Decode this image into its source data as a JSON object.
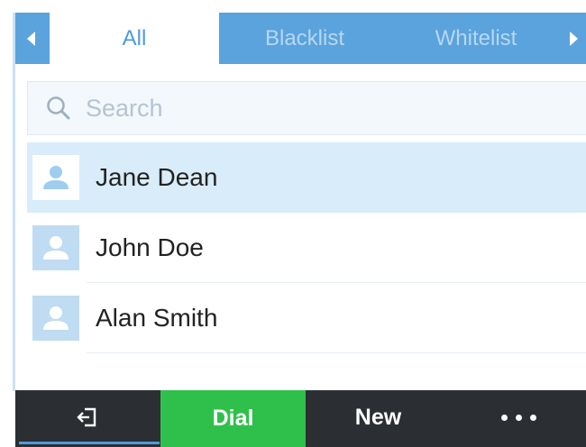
{
  "tabs": [
    {
      "label": "All",
      "active": true
    },
    {
      "label": "Blacklist",
      "active": false
    },
    {
      "label": "Whitelist",
      "active": false
    }
  ],
  "search": {
    "placeholder": "Search",
    "value": "",
    "icon": "search-icon"
  },
  "contacts": [
    {
      "name": "Jane Dean",
      "selected": true,
      "icon": "person-icon"
    },
    {
      "name": "John Doe",
      "selected": false,
      "icon": "person-icon"
    },
    {
      "name": "Alan Smith",
      "selected": false,
      "icon": "person-icon"
    }
  ],
  "bottom_bar": {
    "back_icon": "exit-icon",
    "dial_label": "Dial",
    "new_label": "New",
    "more_icon": "more-dots-icon"
  },
  "colors": {
    "tab_bar": "#5aa3dd",
    "tab_active_text": "#4d9bdc",
    "selected_row": "#d9ecfa",
    "bottom_bar": "#2b2e33",
    "dial_button": "#2fc04c"
  }
}
